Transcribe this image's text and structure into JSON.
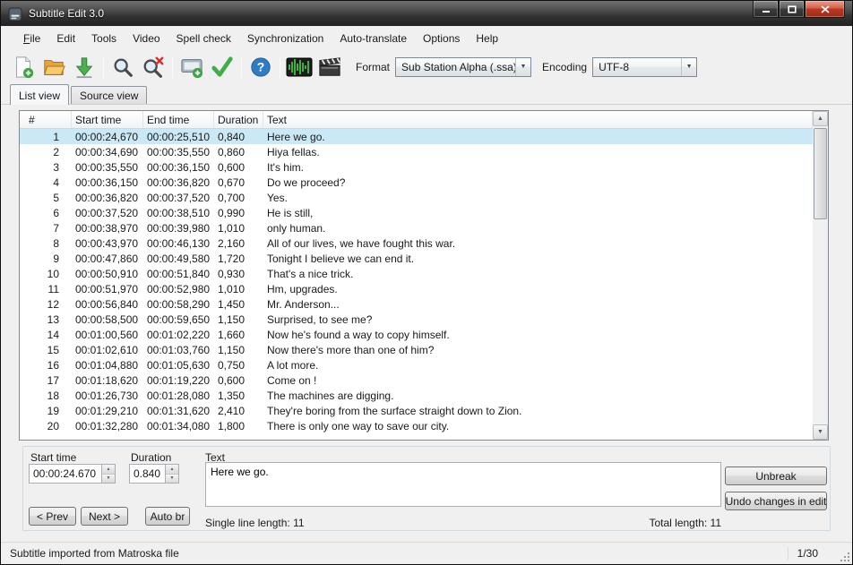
{
  "window": {
    "title": "Subtitle Edit 3.0"
  },
  "colors": {
    "selection": "#cbe8f6",
    "accent_green": "#43a047",
    "close_button": "#b93a22",
    "titlebar": "#3c3c3c"
  },
  "menu": {
    "items": [
      {
        "label": "File"
      },
      {
        "label": "Edit"
      },
      {
        "label": "Tools"
      },
      {
        "label": "Video"
      },
      {
        "label": "Spell check"
      },
      {
        "label": "Synchronization"
      },
      {
        "label": "Auto-translate"
      },
      {
        "label": "Options"
      },
      {
        "label": "Help"
      }
    ]
  },
  "toolbar": {
    "icons": [
      "new-file",
      "open-file",
      "save",
      "find",
      "replace",
      "visual-sync",
      "spell-check",
      "help",
      "waveform",
      "video-clapper"
    ],
    "format_label": "Format",
    "format_value": "Sub Station Alpha (.ssa)",
    "encoding_label": "Encoding",
    "encoding_value": "UTF-8"
  },
  "tabs": {
    "list_view": "List view",
    "source_view": "Source view"
  },
  "table": {
    "columns": [
      "#",
      "Start time",
      "End time",
      "Duration",
      "Text"
    ],
    "rows": [
      {
        "num": "1",
        "start": "00:00:24,670",
        "end": "00:00:25,510",
        "duration": "0,840",
        "text": "Here we go.",
        "selected": true
      },
      {
        "num": "2",
        "start": "00:00:34,690",
        "end": "00:00:35,550",
        "duration": "0,860",
        "text": "Hiya fellas.",
        "selected": false
      },
      {
        "num": "3",
        "start": "00:00:35,550",
        "end": "00:00:36,150",
        "duration": "0,600",
        "text": "It's him.",
        "selected": false
      },
      {
        "num": "4",
        "start": "00:00:36,150",
        "end": "00:00:36,820",
        "duration": "0,670",
        "text": "Do we proceed?",
        "selected": false
      },
      {
        "num": "5",
        "start": "00:00:36,820",
        "end": "00:00:37,520",
        "duration": "0,700",
        "text": "Yes.",
        "selected": false
      },
      {
        "num": "6",
        "start": "00:00:37,520",
        "end": "00:00:38,510",
        "duration": "0,990",
        "text": "He is still,",
        "selected": false
      },
      {
        "num": "7",
        "start": "00:00:38,970",
        "end": "00:00:39,980",
        "duration": "1,010",
        "text": "only human.",
        "selected": false
      },
      {
        "num": "8",
        "start": "00:00:43,970",
        "end": "00:00:46,130",
        "duration": "2,160",
        "text": "All of our lives, we have fought this war.",
        "selected": false
      },
      {
        "num": "9",
        "start": "00:00:47,860",
        "end": "00:00:49,580",
        "duration": "1,720",
        "text": "Tonight I believe we can end it.",
        "selected": false
      },
      {
        "num": "10",
        "start": "00:00:50,910",
        "end": "00:00:51,840",
        "duration": "0,930",
        "text": "That's a nice trick.",
        "selected": false
      },
      {
        "num": "11",
        "start": "00:00:51,970",
        "end": "00:00:52,980",
        "duration": "1,010",
        "text": "Hm, upgrades.",
        "selected": false
      },
      {
        "num": "12",
        "start": "00:00:56,840",
        "end": "00:00:58,290",
        "duration": "1,450",
        "text": "Mr. Anderson...",
        "selected": false
      },
      {
        "num": "13",
        "start": "00:00:58,500",
        "end": "00:00:59,650",
        "duration": "1,150",
        "text": "Surprised, to see me?",
        "selected": false
      },
      {
        "num": "14",
        "start": "00:01:00,560",
        "end": "00:01:02,220",
        "duration": "1,660",
        "text": "Now he's found a way to copy himself.",
        "selected": false
      },
      {
        "num": "15",
        "start": "00:01:02,610",
        "end": "00:01:03,760",
        "duration": "1,150",
        "text": "Now there's more than one of him?",
        "selected": false
      },
      {
        "num": "16",
        "start": "00:01:04,880",
        "end": "00:01:05,630",
        "duration": "0,750",
        "text": "A lot more.",
        "selected": false
      },
      {
        "num": "17",
        "start": "00:01:18,620",
        "end": "00:01:19,220",
        "duration": "0,600",
        "text": "Come on !",
        "selected": false
      },
      {
        "num": "18",
        "start": "00:01:26,730",
        "end": "00:01:28,080",
        "duration": "1,350",
        "text": "The machines are digging.",
        "selected": false
      },
      {
        "num": "19",
        "start": "00:01:29,210",
        "end": "00:01:31,620",
        "duration": "2,410",
        "text": "They're boring from the surface straight down to Zion.",
        "selected": false
      },
      {
        "num": "20",
        "start": "00:01:32,280",
        "end": "00:01:34,080",
        "duration": "1,800",
        "text": "There is only one way to save our city.",
        "selected": false
      }
    ]
  },
  "edit_panel": {
    "start_time_label": "Start time",
    "start_time_value": "00:00:24.670",
    "duration_label": "Duration",
    "duration_value": "0.840",
    "text_label": "Text",
    "text_value": "Here we go.",
    "prev_button": "< Prev",
    "next_button": "Next >",
    "auto_br_button": "Auto br",
    "unbreak_button": "Unbreak",
    "undo_button": "Undo changes in edit",
    "single_line_length": "Single line length: 11",
    "total_length": "Total length: 11"
  },
  "status_bar": {
    "message": "Subtitle imported from Matroska file",
    "position": "1/30"
  }
}
